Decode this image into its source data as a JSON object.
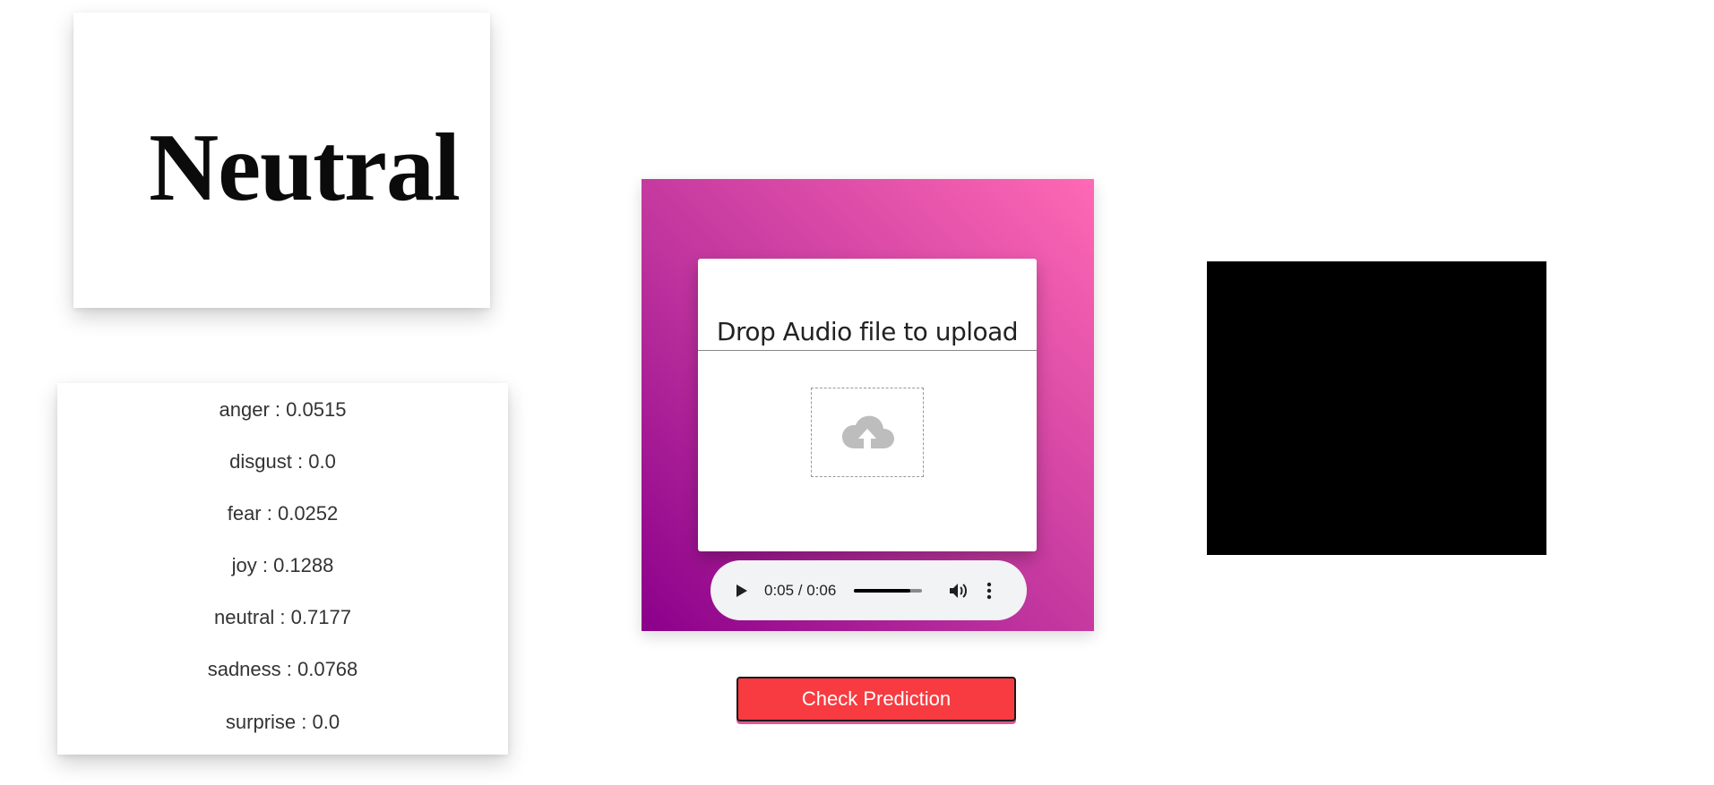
{
  "emotion_image": {
    "word": "Neutral"
  },
  "scores": [
    {
      "label": "anger : 0.0515"
    },
    {
      "label": "disgust : 0.0"
    },
    {
      "label": "fear : 0.0252"
    },
    {
      "label": "joy : 0.1288"
    },
    {
      "label": "neutral : 0.7177"
    },
    {
      "label": "sadness : 0.0768"
    },
    {
      "label": "surprise : 0.0"
    }
  ],
  "upload": {
    "title": "Drop Audio file to upload",
    "icon": "cloud-upload-icon"
  },
  "audio_player": {
    "time": "0:05 / 0:06",
    "progress": 0.83,
    "play_icon": "play-icon",
    "volume_icon": "volume-icon",
    "more_icon": "more-vert-icon"
  },
  "actions": {
    "check_label": "Check Prediction"
  },
  "colors": {
    "panel_gradient_start": "#8b008b",
    "panel_gradient_end": "#ff69b4",
    "check_button": "#f73b40",
    "preview_box": "#000000"
  }
}
